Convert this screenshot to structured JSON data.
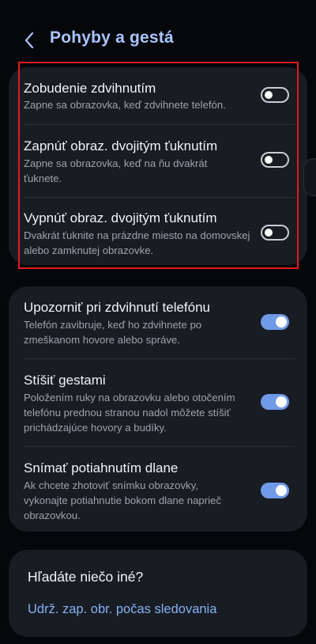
{
  "header": {
    "title": "Pohyby a gestá"
  },
  "group1": [
    {
      "title": "Zobudenie zdvihnutím",
      "desc": "Zapne sa obrazovka, keď zdvihnete telefón.",
      "enabled": false
    },
    {
      "title": "Zapnúť obraz. dvojitým ťuknutím",
      "desc": "Zapne sa obrazovka, keď na ňu dvakrát ťuknete.",
      "enabled": false
    },
    {
      "title": "Vypnúť obraz. dvojitým ťuknutím",
      "desc": "Dvakrát ťuknite na prázdne miesto na domovskej alebo zamknutej obrazovke.",
      "enabled": false
    }
  ],
  "group2": [
    {
      "title": "Upozorniť pri zdvihnutí telefónu",
      "desc": "Telefón zavibruje, keď ho zdvihnete po zmeškanom hovore alebo správe.",
      "enabled": true
    },
    {
      "title": "Stíšiť gestami",
      "desc": "Položením ruky na obrazovku alebo otočením telefónu prednou stranou nadol môžete stíšiť prichádzajúce hovory a budíky.",
      "enabled": true
    },
    {
      "title": "Snímať potiahnutím dlane",
      "desc": "Ak chcete zhotoviť snímku obrazovky, vykonajte potiahnutie bokom dlane naprieč obrazovkou.",
      "enabled": true
    }
  ],
  "suggestions": {
    "title": "Hľadáte niečo iné?",
    "link": "Udrž. zap. obr. počas sledovania"
  },
  "colors": {
    "accent": "#6f9ae8",
    "highlight": "#e01c1c",
    "card": "#181c23"
  }
}
